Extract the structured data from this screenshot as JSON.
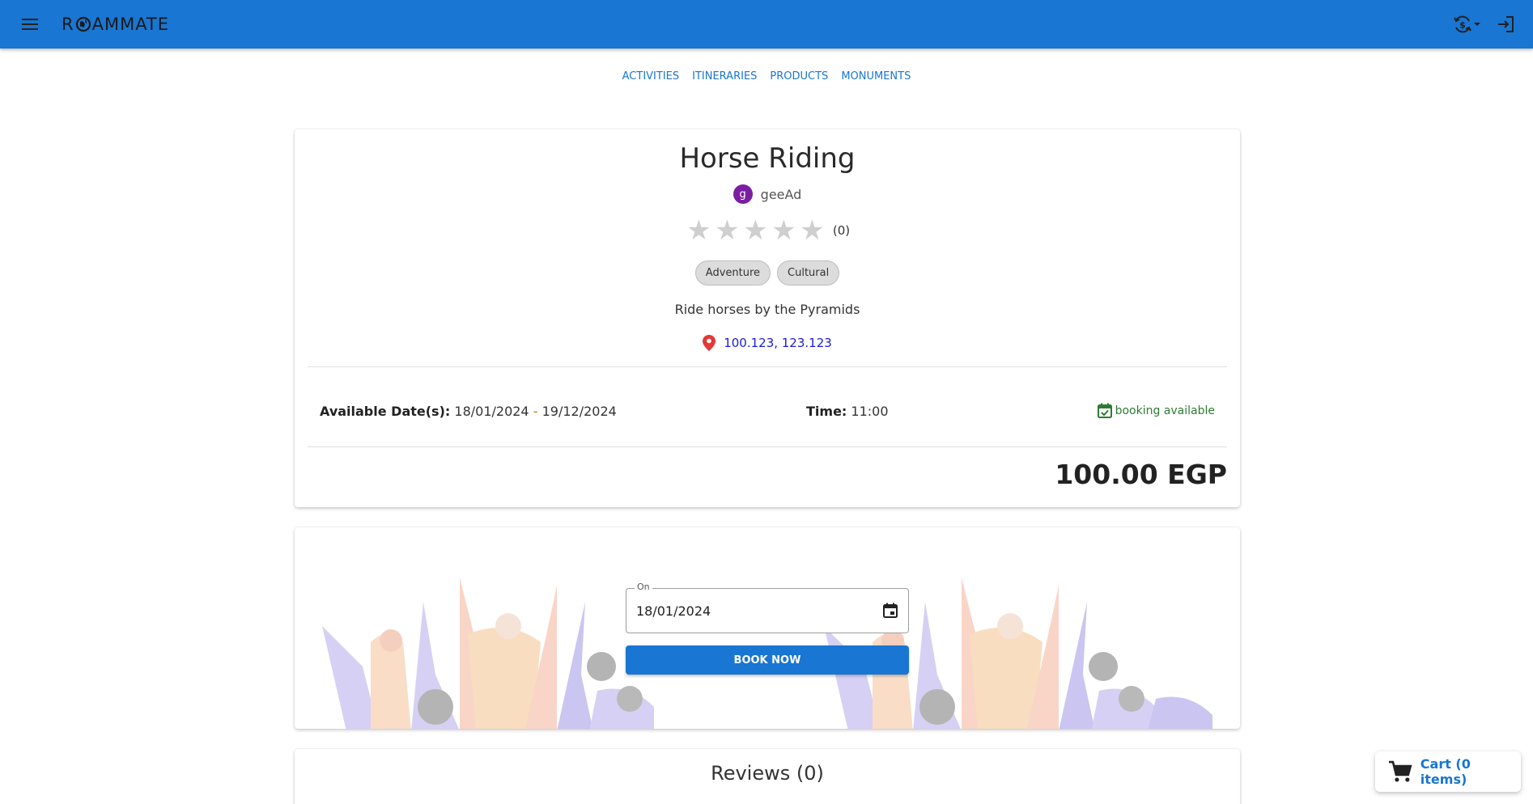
{
  "app": {
    "logo_prefix": "R",
    "logo_suffix": "AMMATE"
  },
  "nav": {
    "links": [
      "ACTIVITIES",
      "ITINERARIES",
      "PRODUCTS",
      "MONUMENTS"
    ]
  },
  "activity": {
    "title": "Horse Riding",
    "author_initial": "g",
    "author_name": "geeAd",
    "rating_stars": 0,
    "rating_max": 5,
    "rating_count": "(0)",
    "tags": [
      "Adventure",
      "Cultural"
    ],
    "description": "Ride horses by the Pyramids",
    "location": "100.123, 123.123",
    "dates_label": "Available Date(s):",
    "date_start": "18/01/2024",
    "date_separator": "-",
    "date_end": "19/12/2024",
    "time_label": "Time:",
    "time_value": "11:00",
    "booking_status": "booking available",
    "price": "100.00 EGP"
  },
  "booking": {
    "date_label": "On",
    "date_value": "18/01/2024",
    "book_button": "BOOK NOW"
  },
  "reviews": {
    "title": "Reviews (0)"
  },
  "cart": {
    "label": "Cart (0 items)"
  },
  "colors": {
    "primary": "#1976d2",
    "avatar": "#7b1fa2",
    "booking_available": "#2e7d32",
    "location_pin": "#e53935",
    "star_empty": "#cfcfcf"
  },
  "icons": {
    "menu": "menu-icon",
    "currency": "currency-exchange-icon",
    "login": "login-icon",
    "location": "location-pin-icon",
    "booking": "event-available-icon",
    "calendar": "calendar-icon",
    "cart": "shopping-cart-icon"
  }
}
